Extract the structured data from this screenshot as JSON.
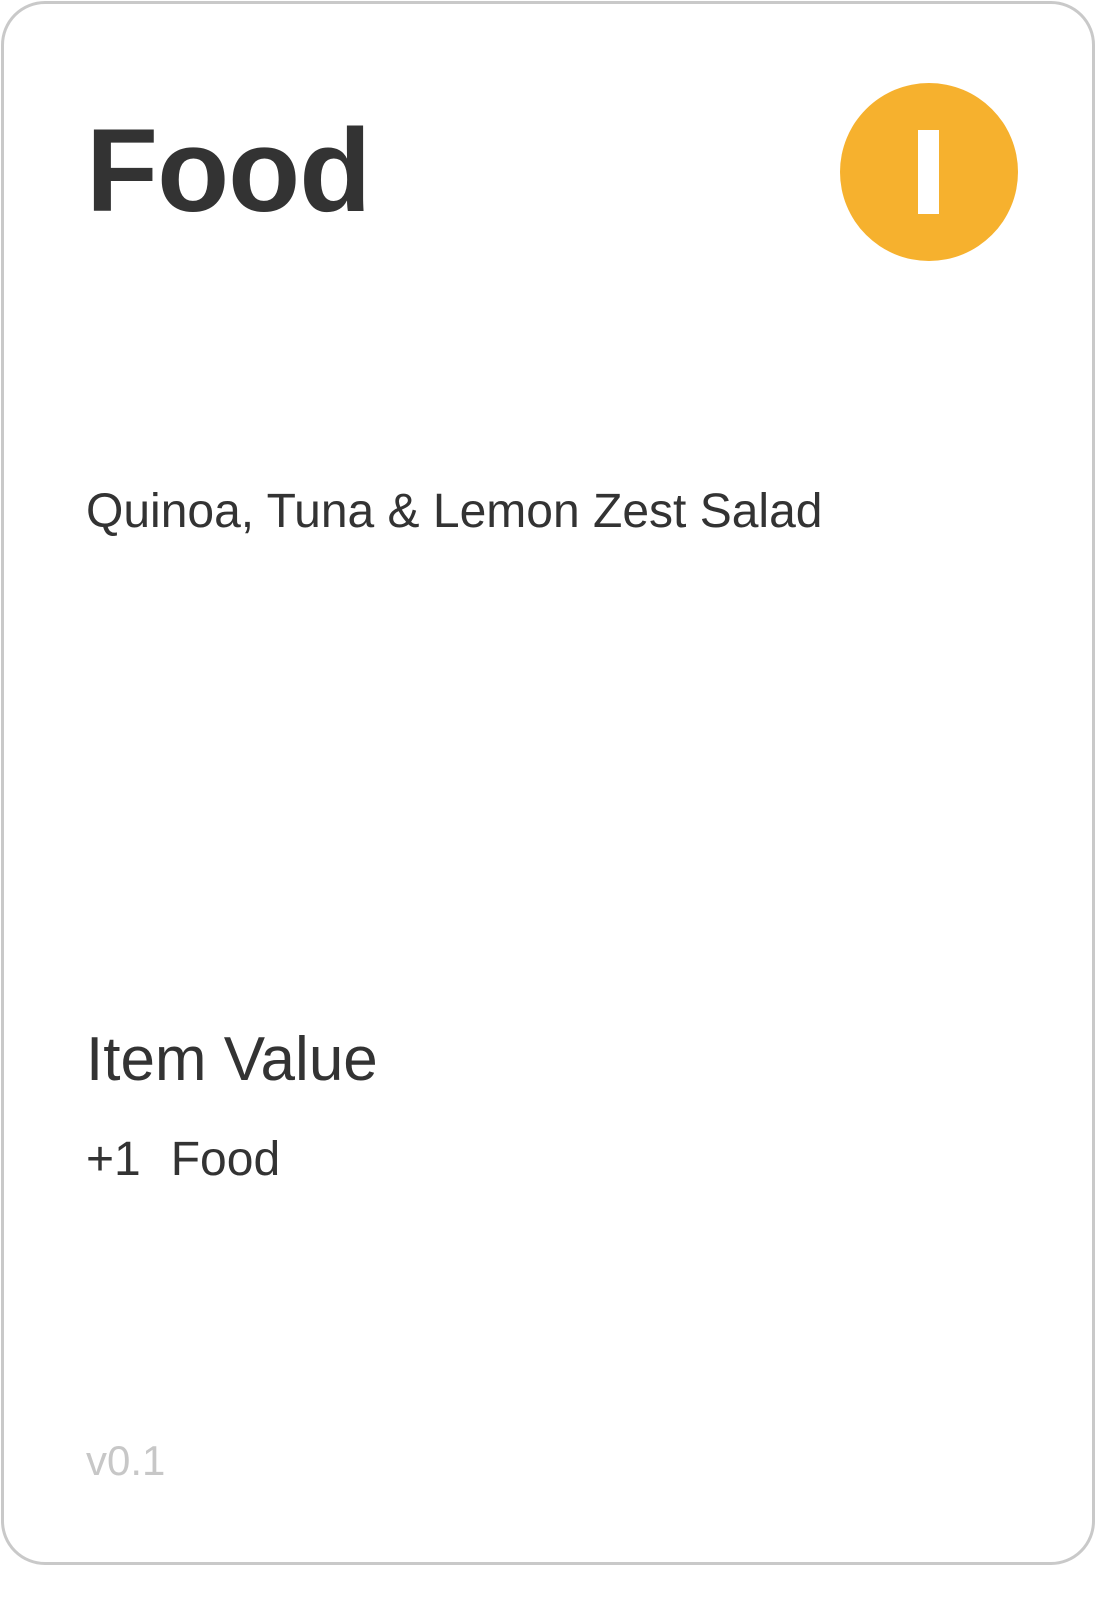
{
  "card": {
    "title": "Food",
    "badge": {
      "icon": "vertical-bar-icon",
      "color": "#f6b12e"
    },
    "item_name": "Quinoa, Tuna & Lemon Zest Salad",
    "item_value": {
      "heading": "Item Value",
      "amount": "+1",
      "resource": "Food"
    },
    "version": "v0.1"
  }
}
